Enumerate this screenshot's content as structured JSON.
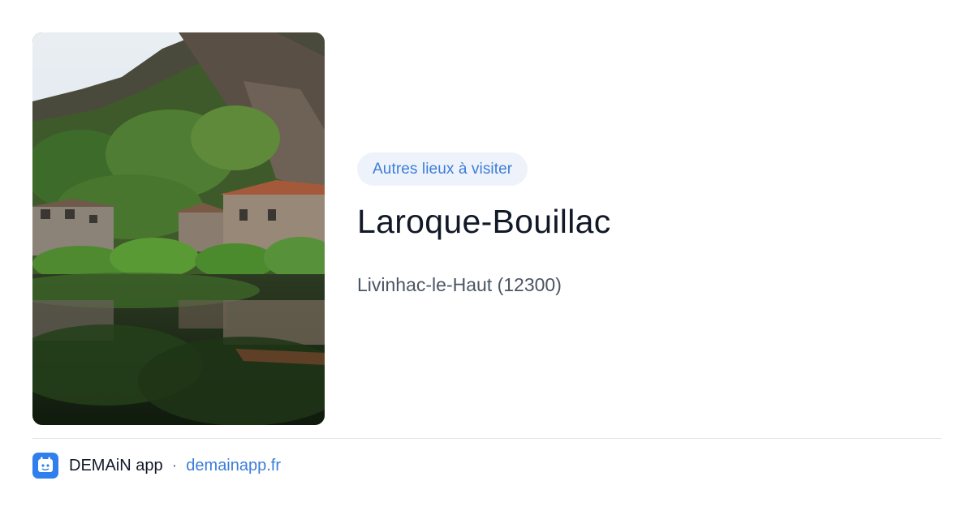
{
  "badge": {
    "label": "Autres lieux à visiter"
  },
  "place": {
    "name": "Laroque-Bouillac",
    "location": "Livinhac-le-Haut (12300)"
  },
  "photo": {
    "alt": "Laroque-Bouillac"
  },
  "footer": {
    "app_name": "DEMAiN app",
    "separator": "·",
    "url": "demainapp.fr"
  },
  "icons": {
    "app": "demain-logo-icon"
  },
  "colors": {
    "accent": "#3b7dd8",
    "badge_bg": "#eef3fb",
    "app_icon_bg": "#2f80ed"
  }
}
